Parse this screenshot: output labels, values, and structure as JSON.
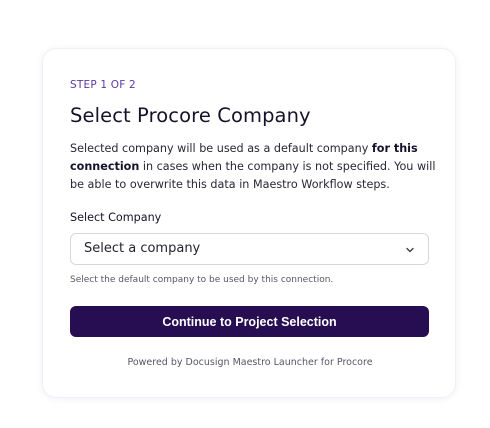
{
  "step": "STEP 1 OF 2",
  "title": "Select Procore Company",
  "description": {
    "part1": "Selected company will be used as a default company ",
    "bold": "for this connection",
    "part2": " in cases when the company is not specified. You will be able to overwrite this data in Maestro Workflow steps."
  },
  "field": {
    "label": "Select Company",
    "placeholder": "Select a company",
    "helper": "Select the default company to be used by this connection."
  },
  "button": {
    "label": "Continue to Project Selection"
  },
  "footer": "Powered by Docusign Maestro Launcher for Procore",
  "colors": {
    "accent": "#5b3aa0",
    "primary_button": "#270e52"
  },
  "icons": {
    "select_chevron": "chevron-down-icon"
  }
}
